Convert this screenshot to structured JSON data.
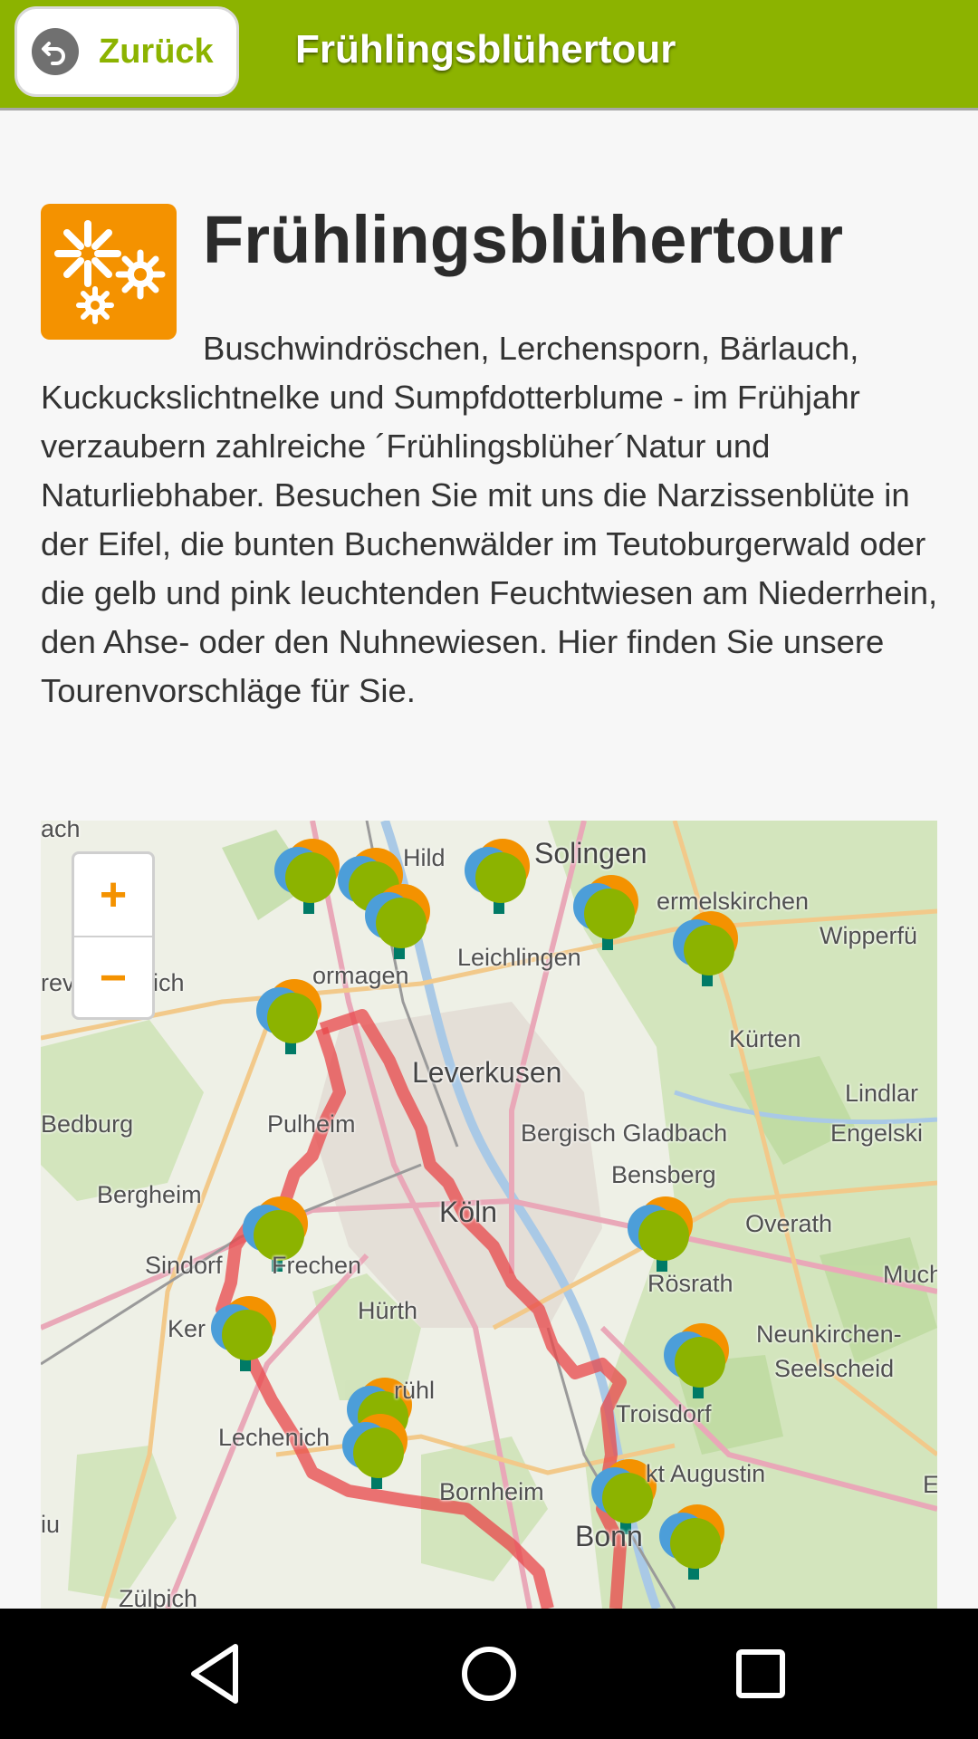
{
  "header": {
    "back_label": "Zurück",
    "title": "Frühlingsblühertour"
  },
  "content": {
    "title": "Frühlingsblühertour",
    "description": "Buschwindröschen, Lerchensporn, Bärlauch, Kuckuckslichtnelke und Sumpfdotterblume - im Frühjahr verzaubern zahlreiche ´Frühlingsblüher´Natur und Naturliebhaber. Besuchen Sie mit uns die Narzissenblüte in der Eifel, die bunten Buchenwälder im Teutoburgerwald oder die gelb und pink leuchtenden Feuchtwiesen am Niederrhein, den Ahse- oder den Nuhnewiesen. Hier finden Sie unsere Tourenvorschläge für Sie.",
    "logo_icon": "flower-cluster-icon"
  },
  "map": {
    "zoom_in": "+",
    "zoom_out": "−",
    "labels": {
      "solingen": "Solingen",
      "hilden": "Hild",
      "leichlingen": "Leichlingen",
      "burscheid": "ermelskirchen",
      "wipperfuerth": "Wipperfü",
      "dormagen": "ormagen",
      "grevenbroich": "rev",
      "ich": "ich",
      "kuerten": "Kürten",
      "leverkusen": "Leverkusen",
      "lindlar": "Lindlar",
      "bedburg": "Bedburg",
      "pulheim": "Pulheim",
      "bergisch_gladbach": "Bergisch Gladbach",
      "engelskirchen": "Engelski",
      "bensberg": "Bensberg",
      "bergheim": "Bergheim",
      "koeln": "Köln",
      "overath": "Overath",
      "sindorf": "Sindorf",
      "frechen": "Frechen",
      "rosrath": "Rösrath",
      "much": "Much",
      "kerpen": "Ker",
      "huerth": "Hürth",
      "neunkirchen": "Neunkirchen-",
      "seelscheid": "Seelscheid",
      "bruehl": "rühl",
      "troisdorf": "Troisdorf",
      "lechenich": "Lechenich",
      "sankt_augustin": "kt Augustin",
      "bornheim": "Bornheim",
      "bonn": "Bonn",
      "zuelpich": "Zülpich",
      "ach": "ach",
      "iu": "iu",
      "e": "E"
    },
    "route_color": "#e8474a",
    "marker_icon": "tree-marker-icon"
  },
  "navbar": {
    "back_icon": "back-triangle-icon",
    "home_icon": "home-circle-icon",
    "recents_icon": "recents-square-icon"
  },
  "colors": {
    "header_bg": "#8cb300",
    "accent_orange": "#f49200"
  }
}
